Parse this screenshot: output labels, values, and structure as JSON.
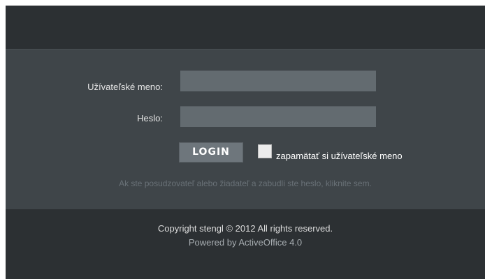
{
  "login": {
    "username_label": "Užívateľské meno:",
    "username_value": "",
    "password_label": "Heslo:",
    "password_value": "",
    "button_label": "LOGIN",
    "remember_label": "zapamätať si užívateľské meno",
    "remember_checked": false,
    "forgot_text": "Ak ste posudzovateľ alebo žiadateľ a zabudli ste heslo, kliknite sem."
  },
  "footer": {
    "copyright": "Copyright stengl © 2012 All rights reserved.",
    "powered_by": "Powered by ActiveOffice 4.0"
  },
  "colors": {
    "background_dark": "#2c3033",
    "panel": "#3f4549",
    "input_fill": "#636b70",
    "button_fill": "#6e767c",
    "muted_link": "#697177"
  }
}
